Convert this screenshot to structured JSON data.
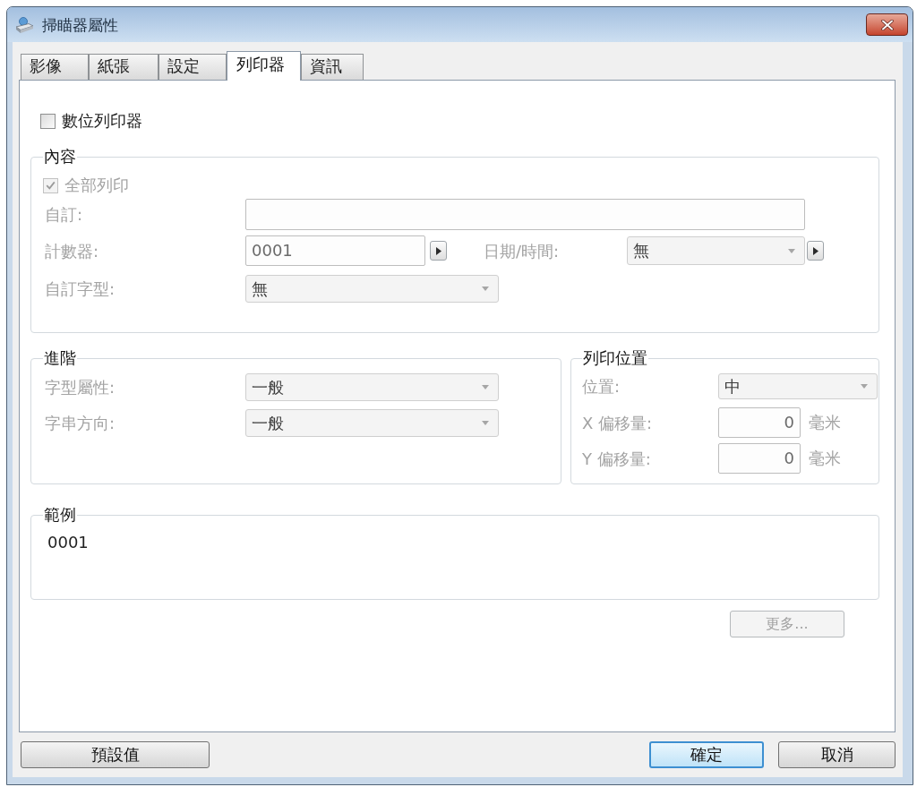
{
  "window": {
    "title": "掃瞄器屬性"
  },
  "tabs": [
    {
      "label": "影像",
      "selected": false
    },
    {
      "label": "紙張",
      "selected": false
    },
    {
      "label": "設定",
      "selected": false
    },
    {
      "label": "列印器",
      "selected": true
    },
    {
      "label": "資訊",
      "selected": false
    }
  ],
  "digital_printer": {
    "label": "數位列印器",
    "checked": false
  },
  "content": {
    "title": "內容",
    "print_all": {
      "label": "全部列印",
      "checked": true,
      "disabled": true
    },
    "custom_text": {
      "label": "自訂:",
      "disabled": true
    },
    "counter": {
      "label": "計數器:",
      "value": "0001",
      "disabled": true
    },
    "date_time": {
      "label": "日期/時間:",
      "value": "無",
      "disabled": true
    },
    "custom_font": {
      "label": "自訂字型:",
      "value": "無",
      "disabled": true
    }
  },
  "advanced": {
    "title": "進階",
    "font_style": {
      "label": "字型屬性:",
      "value": "一般",
      "disabled": true
    },
    "text_direction": {
      "label": "字串方向:",
      "value": "一般",
      "disabled": true
    }
  },
  "print_position": {
    "title": "列印位置",
    "position": {
      "label": "位置:",
      "value": "中",
      "disabled": true
    },
    "x_offset": {
      "label": "X 偏移量:",
      "value": "0",
      "unit": "毫米",
      "disabled": true
    },
    "y_offset": {
      "label": "Y 偏移量:",
      "value": "0",
      "unit": "毫米",
      "disabled": true
    }
  },
  "sample": {
    "title": "範例",
    "text": "0001"
  },
  "more_button": {
    "label": "更多...",
    "disabled": true
  },
  "buttons": [
    {
      "label": "預設值",
      "default": false
    },
    {
      "label": "確定",
      "default": true
    },
    {
      "label": "取消",
      "default": false
    }
  ]
}
